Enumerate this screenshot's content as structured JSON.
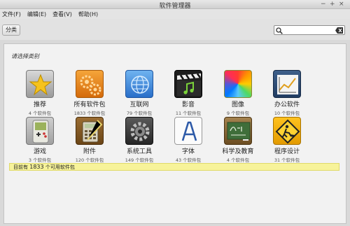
{
  "window": {
    "title": "软件管理器"
  },
  "menu": [
    "文件(F)",
    "编辑(E)",
    "查看(V)",
    "帮助(H)"
  ],
  "toolbar": {
    "category_label": "分类"
  },
  "search": {
    "value": ""
  },
  "main": {
    "heading": "请选择类别"
  },
  "categories": [
    {
      "label": "推荐",
      "count": "4 个软件包",
      "icon": "star-icon"
    },
    {
      "label": "所有软件包",
      "count": "1833 个软件包",
      "icon": "gears-icon"
    },
    {
      "label": "互联网",
      "count": "79 个软件包",
      "icon": "globe-icon"
    },
    {
      "label": "影音",
      "count": "11 个软件包",
      "icon": "clapperboard-icon"
    },
    {
      "label": "图像",
      "count": "9 个软件包",
      "icon": "color-wheel-icon"
    },
    {
      "label": "办公软件",
      "count": "10 个软件包",
      "icon": "chart-icon"
    },
    {
      "label": "游戏",
      "count": "3 个软件包",
      "icon": "gamepad-icon"
    },
    {
      "label": "附件",
      "count": "120 个软件包",
      "icon": "calculator-icon"
    },
    {
      "label": "系统工具",
      "count": "149 个软件包",
      "icon": "system-gear-icon"
    },
    {
      "label": "字体",
      "count": "43 个软件包",
      "icon": "font-icon"
    },
    {
      "label": "科学及教育",
      "count": "4 个软件包",
      "icon": "chalkboard-icon"
    },
    {
      "label": "程序设计",
      "count": "31 个软件包",
      "icon": "construction-icon"
    }
  ],
  "status": {
    "prefix": "目前有",
    "count": "1833",
    "suffix": "个可用软件包"
  }
}
